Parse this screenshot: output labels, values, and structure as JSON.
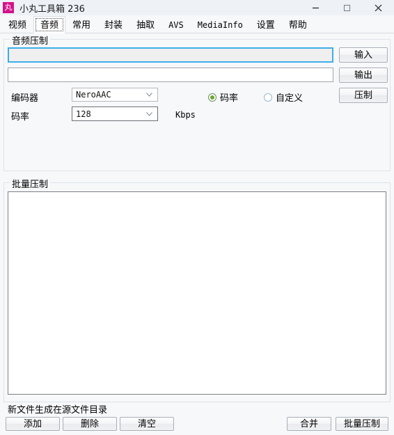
{
  "window": {
    "title": "小丸工具箱 236",
    "icon_glyph": "丸",
    "icon_name": "app-icon-maruko",
    "icon_color": "#d4118b",
    "controls": {
      "minimize": "minimize-icon",
      "maximize": "maximize-icon",
      "close": "close-icon"
    }
  },
  "tabs": [
    {
      "label": "视频",
      "selected": false
    },
    {
      "label": "音频",
      "selected": true
    },
    {
      "label": "常用",
      "selected": false
    },
    {
      "label": "封装",
      "selected": false
    },
    {
      "label": "抽取",
      "selected": false
    },
    {
      "label": "AVS",
      "selected": false
    },
    {
      "label": "MediaInfo",
      "selected": false
    },
    {
      "label": "设置",
      "selected": false
    },
    {
      "label": "帮助",
      "selected": false
    }
  ],
  "audio_group": {
    "title": "音频压制",
    "input_path": {
      "value": "",
      "placeholder": ""
    },
    "output_path": {
      "value": "",
      "placeholder": ""
    },
    "input_button": "输入",
    "output_button": "输出",
    "encode_button": "压制",
    "encoder_label": "编码器",
    "encoder_value": "NeroAAC",
    "bitrate_label": "码率",
    "bitrate_value": "128",
    "bitrate_unit": "Kbps",
    "mode_bitrate": {
      "label": "码率",
      "checked": true
    },
    "mode_custom": {
      "label": "自定义",
      "checked": false
    },
    "radio_accent": "#6aa52f",
    "focus_accent": "#3daee9"
  },
  "batch_group": {
    "title": "批量压制",
    "list_items": [],
    "footnote": "新文件生成在源文件目录",
    "buttons_left": [
      "添加",
      "删除",
      "清空"
    ],
    "buttons_right": [
      "合并",
      "批量压制"
    ]
  }
}
